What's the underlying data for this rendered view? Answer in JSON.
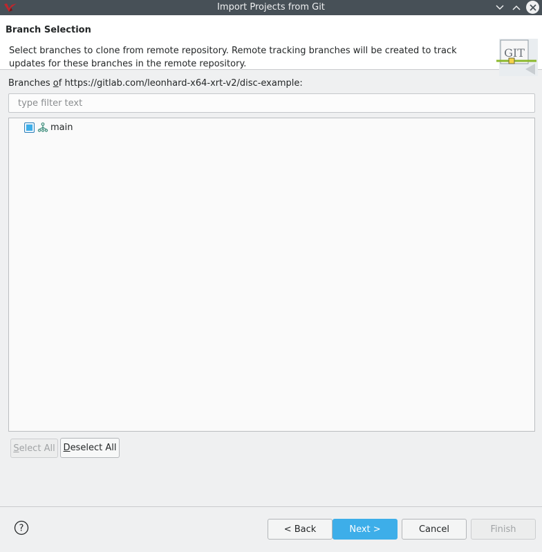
{
  "window": {
    "title": "Import Projects from Git"
  },
  "header": {
    "title": "Branch Selection",
    "description": "Select branches to clone from remote repository. Remote tracking branches will be created to track updates for these branches in the remote repository.",
    "logo_text": "GIT"
  },
  "branches": {
    "label_pre": "Branches ",
    "label_mnemonic": "o",
    "label_post": "f https://gitlab.com/leonhard-x64-xrt-v2/disc-example:",
    "filter_placeholder": "type filter text",
    "items": [
      {
        "name": "main",
        "checked": true
      }
    ]
  },
  "buttons": {
    "select_all": {
      "mnemonic": "S",
      "rest": "elect All",
      "enabled": false
    },
    "deselect_all": {
      "mnemonic": "D",
      "rest": "eselect All",
      "enabled": true
    },
    "back": "< Back",
    "next": "Next >",
    "cancel": "Cancel",
    "finish": {
      "label": "Finish",
      "enabled": false
    }
  },
  "help": {
    "glyph": "?"
  },
  "colors": {
    "titlebar": "#475057",
    "accent": "#3daee9",
    "window_bg": "#eff0f1"
  }
}
